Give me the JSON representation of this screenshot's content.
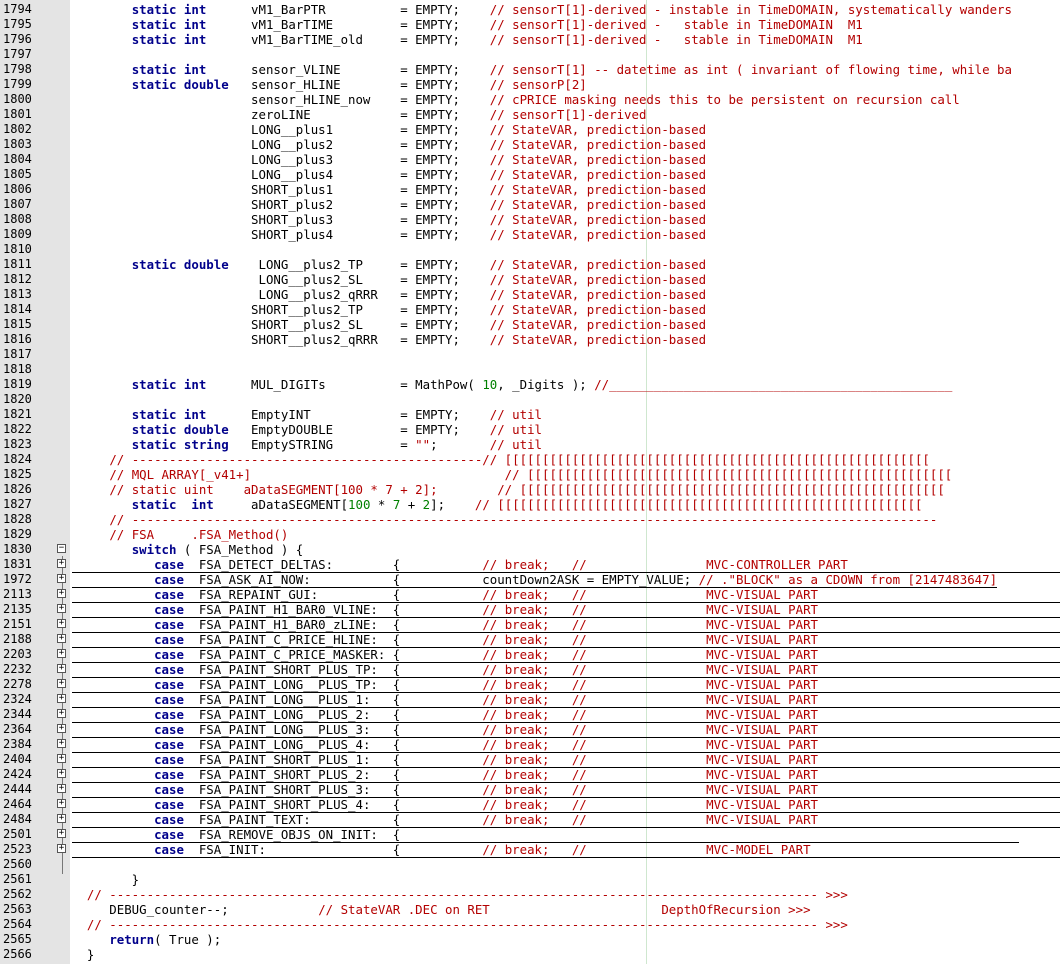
{
  "editor": {
    "lines": [
      {
        "ln": "1794",
        "html": "        <span class=kw>static int</span>      vM1_BarPTR          = EMPTY;    <span class=cm>// sensorT[1]-derived - instable in TimeDOMAIN, systematically wanders</span>"
      },
      {
        "ln": "1795",
        "html": "        <span class=kw>static int</span>      vM1_BarTIME         = EMPTY;    <span class=cm>// sensorT[1]-derived -   stable in TimeDOMAIN  M1</span>"
      },
      {
        "ln": "1796",
        "html": "        <span class=kw>static int</span>      vM1_BarTIME_old     = EMPTY;    <span class=cm>// sensorT[1]-derived -   stable in TimeDOMAIN  M1</span>"
      },
      {
        "ln": "1797",
        "html": ""
      },
      {
        "ln": "1798",
        "html": "        <span class=kw>static int</span>      sensor_VLINE        = EMPTY;    <span class=cm>// sensorT[1] -- datetime as int ( invariant of flowing time, while ba</span>"
      },
      {
        "ln": "1799",
        "html": "        <span class=kw>static double</span>   sensor_HLINE        = EMPTY;    <span class=cm>// sensorP[2]</span>"
      },
      {
        "ln": "1800",
        "html": "                        sensor_HLINE_now    = EMPTY;    <span class=cm>// cPRICE masking needs this to be persistent on recursion call</span>"
      },
      {
        "ln": "1801",
        "html": "                        zeroLINE            = EMPTY;    <span class=cm>// sensorT[1]-derived</span>"
      },
      {
        "ln": "1802",
        "html": "                        LONG__plus1         = EMPTY;    <span class=cm>// StateVAR, prediction-based</span>"
      },
      {
        "ln": "1803",
        "html": "                        LONG__plus2         = EMPTY;    <span class=cm>// StateVAR, prediction-based</span>"
      },
      {
        "ln": "1804",
        "html": "                        LONG__plus3         = EMPTY;    <span class=cm>// StateVAR, prediction-based</span>"
      },
      {
        "ln": "1805",
        "html": "                        LONG__plus4         = EMPTY;    <span class=cm>// StateVAR, prediction-based</span>"
      },
      {
        "ln": "1806",
        "html": "                        SHORT_plus1         = EMPTY;    <span class=cm>// StateVAR, prediction-based</span>"
      },
      {
        "ln": "1807",
        "html": "                        SHORT_plus2         = EMPTY;    <span class=cm>// StateVAR, prediction-based</span>"
      },
      {
        "ln": "1808",
        "html": "                        SHORT_plus3         = EMPTY;    <span class=cm>// StateVAR, prediction-based</span>"
      },
      {
        "ln": "1809",
        "html": "                        SHORT_plus4         = EMPTY;    <span class=cm>// StateVAR, prediction-based</span>"
      },
      {
        "ln": "1810",
        "html": ""
      },
      {
        "ln": "1811",
        "html": "        <span class=kw>static double</span>    LONG__plus2_TP     = EMPTY;    <span class=cm>// StateVAR, prediction-based</span>"
      },
      {
        "ln": "1812",
        "html": "                         LONG__plus2_SL     = EMPTY;    <span class=cm>// StateVAR, prediction-based</span>"
      },
      {
        "ln": "1813",
        "html": "                         LONG__plus2_qRRR   = EMPTY;    <span class=cm>// StateVAR, prediction-based</span>"
      },
      {
        "ln": "1814",
        "html": "                        SHORT__plus2_TP     = EMPTY;    <span class=cm>// StateVAR, prediction-based</span>"
      },
      {
        "ln": "1815",
        "html": "                        SHORT__plus2_SL     = EMPTY;    <span class=cm>// StateVAR, prediction-based</span>"
      },
      {
        "ln": "1816",
        "html": "                        SHORT__plus2_qRRR   = EMPTY;    <span class=cm>// StateVAR, prediction-based</span>"
      },
      {
        "ln": "1817",
        "html": ""
      },
      {
        "ln": "1818",
        "html": ""
      },
      {
        "ln": "1819",
        "html": "        <span class=kw>static int</span>      MUL_DIGITs          = MathPow( <span class=num>10</span>, _Digits ); <span class=cm>//______________________________________________</span>"
      },
      {
        "ln": "1820",
        "html": ""
      },
      {
        "ln": "1821",
        "html": "        <span class=kw>static int</span>      EmptyINT            = EMPTY;    <span class=cm>// util</span>"
      },
      {
        "ln": "1822",
        "html": "        <span class=kw>static double</span>   EmptyDOUBLE         = EMPTY;    <span class=cm>// util</span>"
      },
      {
        "ln": "1823",
        "html": "        <span class=kw>static string</span>   EmptySTRING         = <span class=cm>\"\"</span>;       <span class=cm>// util</span>"
      },
      {
        "ln": "1824",
        "html": "     <span class=cm>// -----------------------------------------------// [[[[[[[[[[[[[[[[[[[[[[[[[[[[[[[[[[[[[[[[[[[[[[[[[[[[[[[[[</span>"
      },
      {
        "ln": "1825",
        "html": "     <span class=cm>// MQL ARRAY[_v41+]                                  // [[[[[[[[[[[[[[[[[[[[[[[[[[[[[[[[[[[[[[[[[[[[[[[[[[[[[[[[[</span>"
      },
      {
        "ln": "1826",
        "html": "     <span class=cm>// static uint    aDataSEGMENT[100 * 7 + 2];        // [[[[[[[[[[[[[[[[[[[[[[[[[[[[[[[[[[[[[[[[[[[[[[[[[[[[[[[[[</span>"
      },
      {
        "ln": "1827",
        "html": "        <span class=kw>static  int</span>     aDataSEGMENT[<span class=num>100</span> * <span class=num>7</span> + <span class=num>2</span>];    <span class=cm>// [[[[[[[[[[[[[[[[[[[[[[[[[[[[[[[[[[[[[[[[[[[[[[[[[[[[[[[[[</span>"
      },
      {
        "ln": "1828",
        "html": "     <span class=cm>// ------------------------------------------------------------------------------------------------------------</span>"
      },
      {
        "ln": "1829",
        "html": "     <span class=cm>// FSA     .FSA_Method()</span>"
      },
      {
        "ln": "1830",
        "html": "        <span class=kw>switch</span> ( FSA_Method ) {",
        "fold": "-"
      },
      {
        "ln": "1831",
        "html": "<span class=uline>           <span class=kw>case</span>  FSA_DETECT_DELTAS:        {           <span class=cm>// break;   //                MVC-CONTROLLER PART</span>                                         </span>",
        "fold": "+"
      },
      {
        "ln": "1972",
        "html": "<span class=uline>           <span class=kw>case</span>  FSA_ASK_AI_NOW:           {           countDown2ASK = EMPTY_VALUE; <span class=cm>// .\"BLOCK\" as a CDOWN from [2147483647]</span></span>",
        "fold": "+"
      },
      {
        "ln": "2113",
        "html": "<span class=uline>           <span class=kw>case</span>  FSA_REPAINT_GUI:          {           <span class=cm>// break;   //                MVC-VISUAL PART</span>                                             </span>",
        "fold": "+"
      },
      {
        "ln": "2135",
        "html": "<span class=uline>           <span class=kw>case</span>  FSA_PAINT_H1_BAR0_VLINE:  {           <span class=cm>// break;   //                MVC-VISUAL PART</span>                                             </span>",
        "fold": "+"
      },
      {
        "ln": "2151",
        "html": "<span class=uline>           <span class=kw>case</span>  FSA_PAINT_H1_BAR0_zLINE:  {           <span class=cm>// break;   //                MVC-VISUAL PART</span>                                             </span>",
        "fold": "+"
      },
      {
        "ln": "2188",
        "html": "<span class=uline>           <span class=kw>case</span>  FSA_PAINT_C_PRICE_HLINE:  {           <span class=cm>// break;   //                MVC-VISUAL PART</span>                                             </span>",
        "fold": "+"
      },
      {
        "ln": "2203",
        "html": "<span class=uline>           <span class=kw>case</span>  FSA_PAINT_C_PRICE_MASKER: {           <span class=cm>// break;   //                MVC-VISUAL PART</span>                                             </span>",
        "fold": "+"
      },
      {
        "ln": "2232",
        "html": "<span class=uline>           <span class=kw>case</span>  FSA_PAINT_SHORT_PLUS_TP:  {           <span class=cm>// break;   //                MVC-VISUAL PART</span>                                             </span>",
        "fold": "+"
      },
      {
        "ln": "2278",
        "html": "<span class=uline>           <span class=kw>case</span>  FSA_PAINT_LONG__PLUS_TP:  {           <span class=cm>// break;   //                MVC-VISUAL PART</span>                                             </span>",
        "fold": "+"
      },
      {
        "ln": "2324",
        "html": "<span class=uline>           <span class=kw>case</span>  FSA_PAINT_LONG__PLUS_1:   {           <span class=cm>// break;   //                MVC-VISUAL PART</span>                                             </span>",
        "fold": "+"
      },
      {
        "ln": "2344",
        "html": "<span class=uline>           <span class=kw>case</span>  FSA_PAINT_LONG__PLUS_2:   {           <span class=cm>// break;   //                MVC-VISUAL PART</span>                                             </span>",
        "fold": "+"
      },
      {
        "ln": "2364",
        "html": "<span class=uline>           <span class=kw>case</span>  FSA_PAINT_LONG__PLUS_3:   {           <span class=cm>// break;   //                MVC-VISUAL PART</span>                                             </span>",
        "fold": "+"
      },
      {
        "ln": "2384",
        "html": "<span class=uline>           <span class=kw>case</span>  FSA_PAINT_LONG__PLUS_4:   {           <span class=cm>// break;   //                MVC-VISUAL PART</span>                                             </span>",
        "fold": "+"
      },
      {
        "ln": "2404",
        "html": "<span class=uline>           <span class=kw>case</span>  FSA_PAINT_SHORT_PLUS_1:   {           <span class=cm>// break;   //                MVC-VISUAL PART</span>                                             </span>",
        "fold": "+"
      },
      {
        "ln": "2424",
        "html": "<span class=uline>           <span class=kw>case</span>  FSA_PAINT_SHORT_PLUS_2:   {           <span class=cm>// break;   //                MVC-VISUAL PART</span>                                             </span>",
        "fold": "+"
      },
      {
        "ln": "2444",
        "html": "<span class=uline>           <span class=kw>case</span>  FSA_PAINT_SHORT_PLUS_3:   {           <span class=cm>// break;   //                MVC-VISUAL PART</span>                                             </span>",
        "fold": "+"
      },
      {
        "ln": "2464",
        "html": "<span class=uline>           <span class=kw>case</span>  FSA_PAINT_SHORT_PLUS_4:   {           <span class=cm>// break;   //                MVC-VISUAL PART</span>                                             </span>",
        "fold": "+"
      },
      {
        "ln": "2484",
        "html": "<span class=uline>           <span class=kw>case</span>  FSA_PAINT_TEXT:           {           <span class=cm>// break;   //                MVC-VISUAL PART</span>                                             </span>",
        "fold": "+"
      },
      {
        "ln": "2501",
        "html": "<span class=uline>           <span class=kw>case</span>  FSA_REMOVE_OBJS_ON_INIT:  {                                                                                   </span>",
        "fold": "+"
      },
      {
        "ln": "2523",
        "html": "<span class=uline>           <span class=kw>case</span>  FSA_INIT:                 {           <span class=cm>// break;   //                MVC-MODEL PART</span>                                              </span>",
        "fold": "+"
      },
      {
        "ln": "2560",
        "html": ""
      },
      {
        "ln": "2561",
        "html": "        }"
      },
      {
        "ln": "2562",
        "html": "  <span class=cm>// ----------------------------------------------------------------------------------------------- >>></span>"
      },
      {
        "ln": "2563",
        "html": "     DEBUG_counter--;            <span class=cm>// StateVAR .DEC on RET</span>                       <span class=cm>DepthOfRecursion >>></span>"
      },
      {
        "ln": "2564",
        "html": "  <span class=cm>// ----------------------------------------------------------------------------------------------- >>></span>"
      },
      {
        "ln": "2565",
        "html": "     <span class=kw>return</span>( True );"
      },
      {
        "ln": "2566",
        "html": "  }"
      }
    ]
  }
}
